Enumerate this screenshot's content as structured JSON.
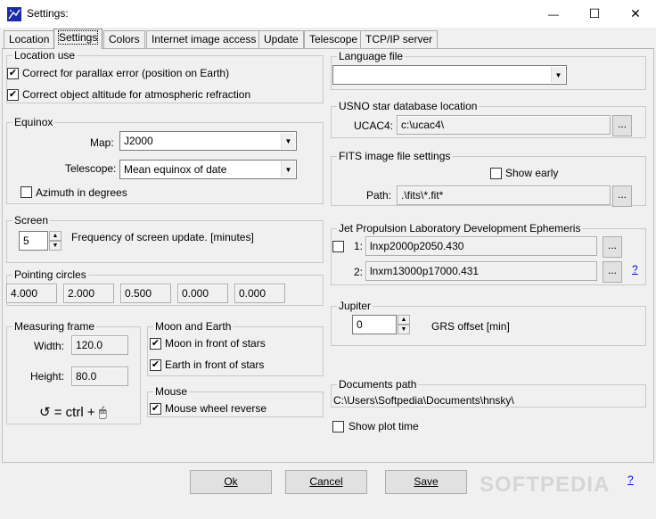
{
  "window": {
    "title": "Settings:",
    "minimize_glyph": "—",
    "maximize_glyph": "☐",
    "close_glyph": "✕"
  },
  "tabs": [
    {
      "label": "Location",
      "active": false
    },
    {
      "label": "Settings",
      "active": true
    },
    {
      "label": "Colors",
      "active": false
    },
    {
      "label": "Internet image access",
      "active": false
    },
    {
      "label": "Update",
      "active": false
    },
    {
      "label": "Telescope",
      "active": false
    },
    {
      "label": "TCP/IP server",
      "active": false
    }
  ],
  "location_use": {
    "title": "Location use",
    "parallax": {
      "label": "Correct for parallax error (position on Earth)",
      "checked": true
    },
    "refraction": {
      "label": "Correct object altitude for atmospheric refraction",
      "checked": true
    }
  },
  "equinox": {
    "title": "Equinox",
    "map_label": "Map:",
    "map_value": "J2000",
    "telescope_label": "Telescope:",
    "telescope_value": "Mean equinox of date",
    "azimuth": {
      "label": "Azimuth in degrees",
      "checked": false
    }
  },
  "screen": {
    "title": "Screen",
    "value": "5",
    "label": "Frequency of screen update.  [minutes]"
  },
  "pointing_circles": {
    "title": "Pointing circles",
    "values": [
      "4.000",
      "2.000",
      "0.500",
      "0.000",
      "0.000"
    ]
  },
  "measuring_frame": {
    "title": "Measuring frame",
    "width_label": "Width:",
    "width_value": "120.0",
    "height_label": "Height:",
    "height_value": "80.0",
    "hint": "↺ = ctrl + 🖱"
  },
  "moon_earth": {
    "title": "Moon and Earth",
    "moon": {
      "label": "Moon in front of stars",
      "checked": true
    },
    "earth": {
      "label": "Earth in front of stars",
      "checked": true
    }
  },
  "mouse": {
    "title": "Mouse",
    "wheel": {
      "label": "Mouse wheel reverse",
      "checked": true
    }
  },
  "language_file": {
    "title": "Language file",
    "value": ""
  },
  "usno": {
    "title": "USNO star database location",
    "label": "UCAC4:",
    "value": "c:\\ucac4\\",
    "browse": "..."
  },
  "fits": {
    "title": "FITS image file settings",
    "show_early": {
      "label": "Show early",
      "checked": false
    },
    "path_label": "Path:",
    "path_value": ".\\fits\\*.fit*",
    "browse": "..."
  },
  "jpl": {
    "title": "Jet Propulsion Laboratory Development Ephemeris",
    "row1_checked": false,
    "row1_label": "1:",
    "row1_value": "lnxp2000p2050.430",
    "row2_label": "2:",
    "row2_value": "lnxm13000p17000.431",
    "browse": "...",
    "help": "?"
  },
  "jupiter": {
    "title": "Jupiter",
    "value": "0",
    "label": "GRS offset [min]"
  },
  "documents": {
    "title": "Documents path",
    "value": "C:\\Users\\Softpedia\\Documents\\hnsky\\"
  },
  "show_plot_time": {
    "label": "Show plot time",
    "checked": false
  },
  "buttons": {
    "ok": "Ok",
    "cancel": "Cancel",
    "save": "Save",
    "help": "?"
  },
  "watermark": "SOFTPEDIA"
}
